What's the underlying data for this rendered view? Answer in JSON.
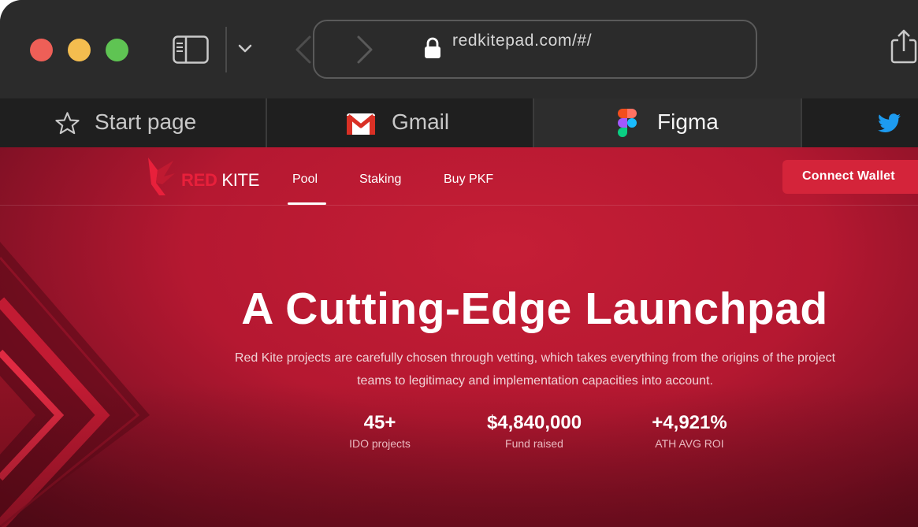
{
  "browser": {
    "url": "redkitepad.com/#/",
    "tabs": [
      {
        "label": "Start page",
        "icon": "star-icon"
      },
      {
        "label": "Gmail",
        "icon": "gmail-icon"
      },
      {
        "label": "Figma",
        "icon": "figma-icon",
        "active": true
      },
      {
        "label": "",
        "icon": "twitter-icon"
      }
    ]
  },
  "site": {
    "logo": {
      "red": "RED",
      "white": "KITE"
    },
    "nav": [
      {
        "label": "Pool",
        "active": true
      },
      {
        "label": "Staking"
      },
      {
        "label": "Buy PKF"
      }
    ],
    "connect_label": "Connect Wallet",
    "hero": {
      "title": "A Cutting-Edge Launchpad",
      "subtitle": "Red Kite projects are carefully chosen through vetting, which takes everything from the origins of the project teams to legitimacy and implementation capacities into account."
    },
    "stats": [
      {
        "value": "45+",
        "label": "IDO projects"
      },
      {
        "value": "$4,840,000",
        "label": "Fund raised"
      },
      {
        "value": "+4,921%",
        "label": "ATH AVG ROI"
      }
    ]
  },
  "colors": {
    "accent": "#d4243a",
    "brand_red": "#e8203b",
    "toolbar": "#2b2b2b"
  }
}
